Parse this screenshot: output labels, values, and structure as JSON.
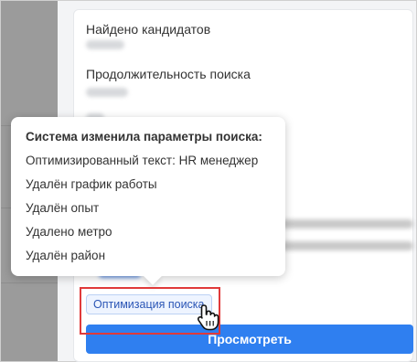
{
  "panel": {
    "found_candidates_label": "Найдено кандидатов",
    "search_duration_label": "Продолжительность поиска"
  },
  "tooltip": {
    "title": "Система изменила параметры поиска:",
    "items": [
      "Оптимизированный текст: HR менеджер",
      "Удалён график работы",
      "Удалён опыт",
      "Удалено метро",
      "Удалён район"
    ]
  },
  "chip": {
    "label": "Оптимизация поиска"
  },
  "view_button": {
    "label": "Просмотреть"
  },
  "colors": {
    "accent": "#2f7ff0",
    "highlight": "#e03a3a",
    "chip_text": "#2a55b5"
  }
}
